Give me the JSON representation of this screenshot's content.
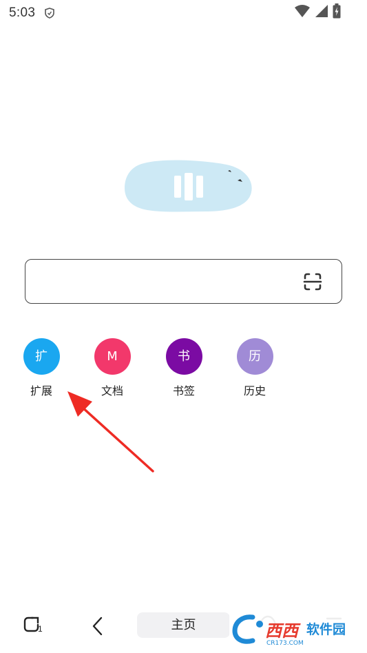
{
  "status_bar": {
    "time": "5:03",
    "icons": [
      "shield-icon",
      "wifi-icon",
      "signal-icon",
      "battery-charging-icon"
    ]
  },
  "logo": {
    "icon": "browser-logo-cloud",
    "color": "#cde9f5"
  },
  "search": {
    "placeholder": "",
    "value": "",
    "scan_icon": "scan-icon"
  },
  "shortcuts": [
    {
      "glyph": "扩",
      "label": "扩展",
      "color": "#1aa7f0"
    },
    {
      "glyph": "M",
      "label": "文档",
      "color": "#f2386b"
    },
    {
      "glyph": "书",
      "label": "书签",
      "color": "#7b0ba3"
    },
    {
      "glyph": "历",
      "label": "历史",
      "color": "#a08bd6"
    }
  ],
  "annotation": {
    "type": "red-arrow",
    "target": "扩展",
    "color": "#ee2b24"
  },
  "bottom_nav": {
    "tabs_icon": "tabs-icon",
    "tabs_count": "1",
    "back_icon": "back-icon",
    "home_label": "主页",
    "user_icon": "user-icon",
    "menu_icon": "menu-icon"
  },
  "watermark": {
    "brand": "西西软件园",
    "site": "CR173.COM"
  }
}
